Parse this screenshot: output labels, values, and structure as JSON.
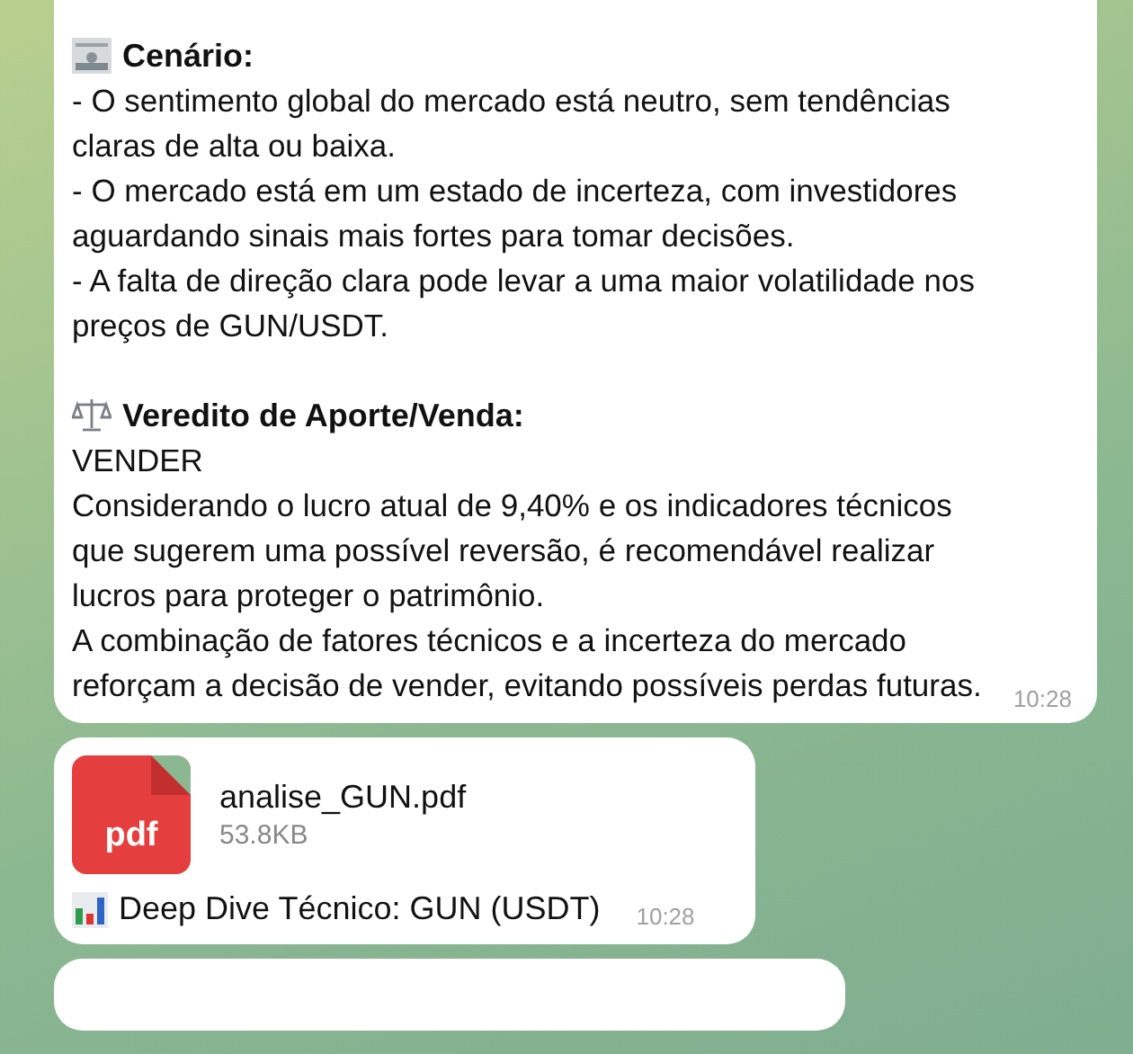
{
  "messages": [
    {
      "kind": "text",
      "sections": [
        {
          "heading": "Cenário:",
          "paragraphs": [
            "- O sentimento global do mercado está neutro, sem tendências claras de alta ou baixa.",
            "- O mercado está em um estado de incerteza, com investidores aguardando sinais mais fortes para tomar decisões.",
            "- A falta de direção clara pode levar a uma maior volatilidade nos preços de GUN/USDT."
          ]
        },
        {
          "heading": "Veredito de Aporte/Venda:",
          "paragraphs": [
            "VENDER",
            "Considerando o lucro atual de 9,40% e os indicadores técnicos que sugerem uma possível reversão, é recomendável realizar lucros para proteger o patrimônio.",
            "A combinação de fatores técnicos e a incerteza do mercado reforçam a decisão de vender, evitando possíveis perdas futuras."
          ]
        }
      ],
      "time": "10:28"
    },
    {
      "kind": "file",
      "file_type": "pdf",
      "file_name": "analise_GUN.pdf",
      "file_size": "53.8KB",
      "caption": "Deep Dive Técnico: GUN (USDT)",
      "time": "10:28"
    },
    {
      "kind": "partial"
    }
  ]
}
